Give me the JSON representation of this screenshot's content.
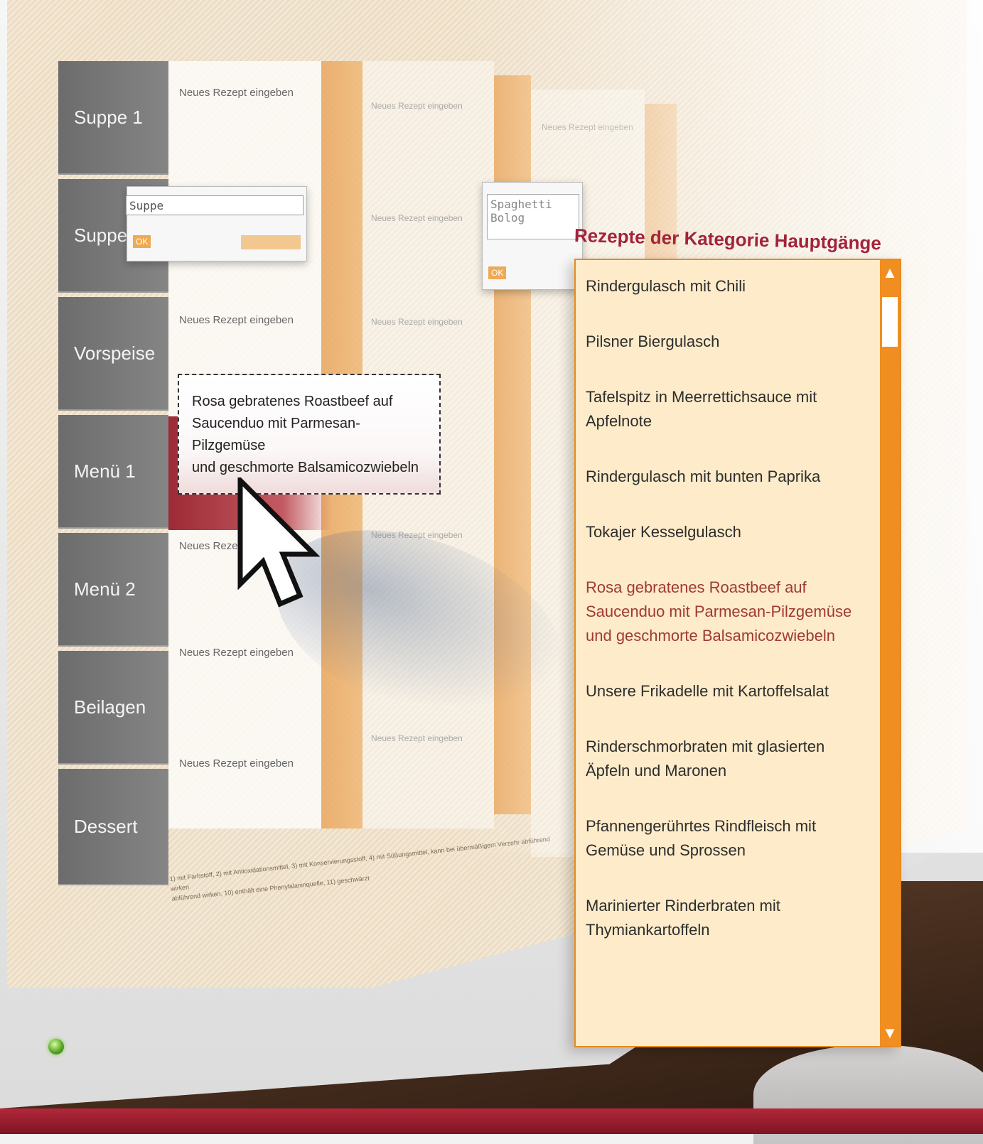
{
  "plan": {
    "rows": [
      "Suppe 1",
      "Suppe",
      "Vorspeise",
      "Menü 1",
      "Menü 2",
      "Beilagen",
      "Dessert"
    ],
    "placeholder": "Neues Rezept eingeben",
    "footnote_line1": "1) mit Farbstoff, 2) mit Antioxidationsmittel, 3) mit Konservierungsstoff, 4) mit Süßungsmittel, kann bei übermäßigem Verzehr abführend wirken",
    "footnote_line2": "abführend wirken, 10) enthält eine Phenylalaninquelle, 11) geschwärzt"
  },
  "editor_left": {
    "value": "Suppe",
    "ok": "OK"
  },
  "editor_right": {
    "value_line1": "Spaghetti",
    "value_line2": "Bolog",
    "ok": "OK"
  },
  "tooltip": {
    "line1": "Rosa gebratenes Roastbeef auf",
    "line2": "Saucenduo mit Parmesan-Pilzgemüse",
    "line3": "und geschmorte Balsamicozwiebeln"
  },
  "panel": {
    "title": "Rezepte der Kategorie Hauptgänge",
    "recipes": [
      "Rindergulasch mit Chili",
      "Pilsner Biergulasch",
      "Tafelspitz in Meerrettichsauce mit Apfelnote",
      "Rindergulasch mit bunten Paprika",
      "Tokajer Kesselgulasch",
      "Rosa gebratenes Roastbeef auf Saucenduo mit Parmesan-Pilzgemüse und geschmorte Balsamicozwiebeln",
      "Unsere Frikadelle mit Kartoffelsalat",
      "Rinderschmorbraten mit glasierten Äpfeln und Maronen",
      "Pfannengerührtes Rindfleisch mit Gemüse und Sprossen",
      "Marinierter Rinderbraten mit Thymiankartoffeln"
    ],
    "active_index": 5,
    "scroll_up_icon": "arrow-up-icon",
    "scroll_down_icon": "arrow-down-icon"
  },
  "colors": {
    "accent": "#a3233a",
    "orange": "#f08e21",
    "panel_bg": "#fdebc9",
    "row_label_bg": "#6c6c6c"
  }
}
